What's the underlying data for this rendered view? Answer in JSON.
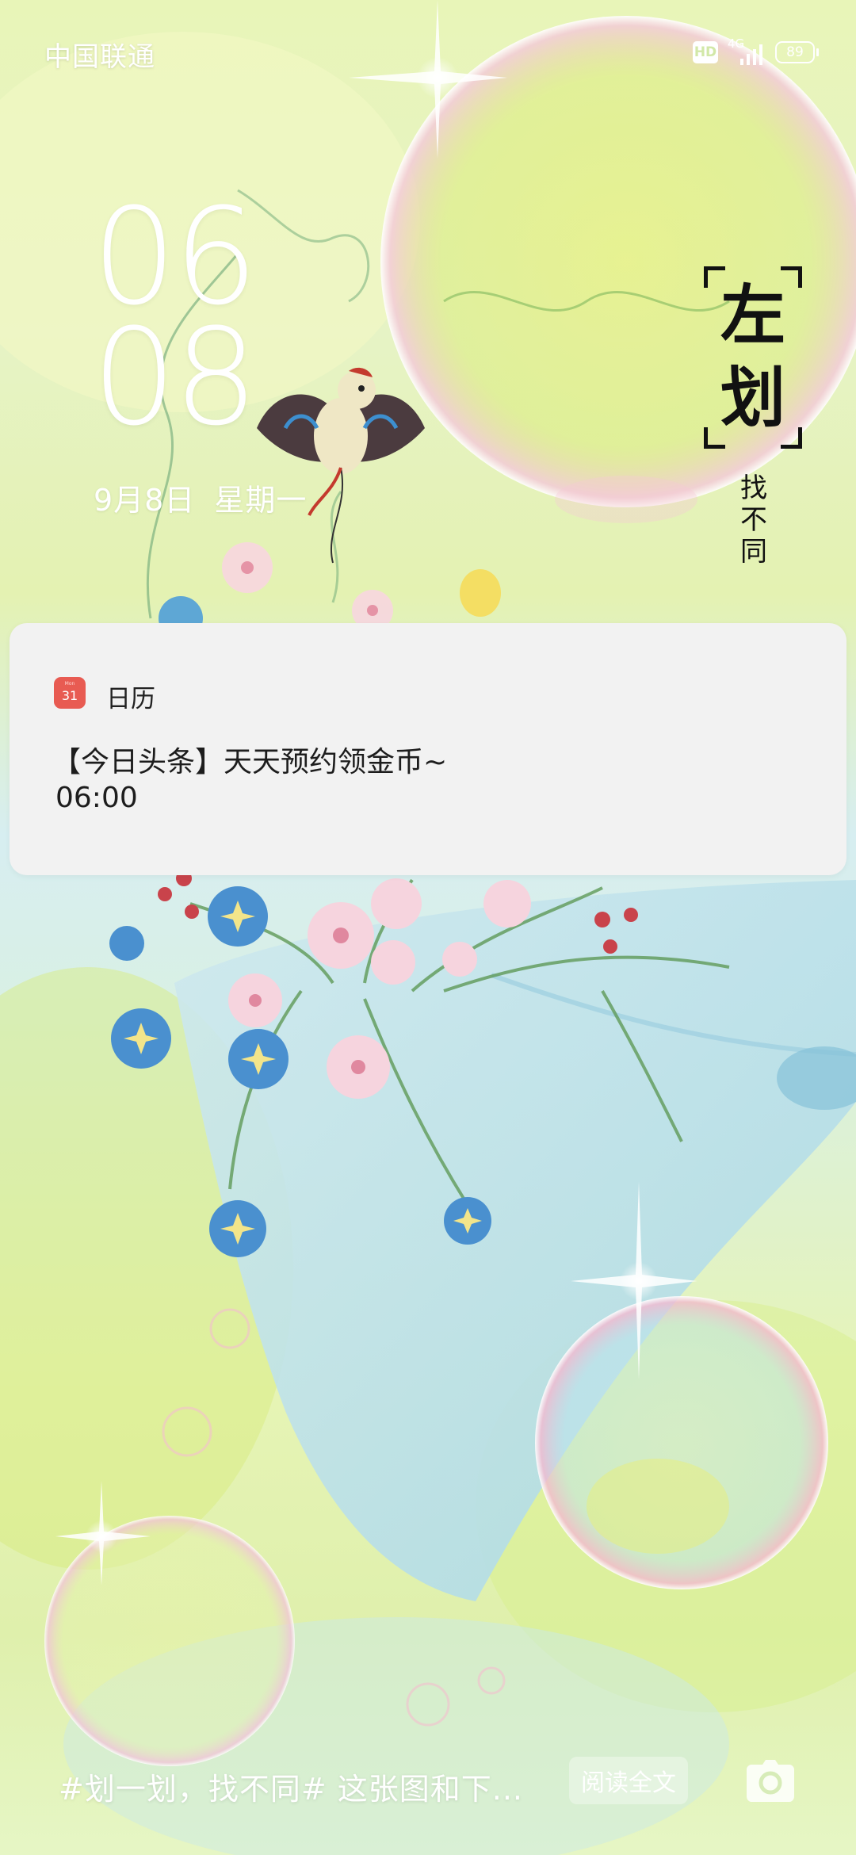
{
  "status_bar": {
    "carrier": "中国联通",
    "hd_label": "HD",
    "network_label": "4G",
    "battery_percent": "89"
  },
  "lock_screen": {
    "clock_hour": "06",
    "clock_minute": "08",
    "date": "9月8日",
    "weekday": "星期一"
  },
  "theme_mark": {
    "big_chars": [
      "左",
      "划"
    ],
    "small_chars": [
      "找",
      "不",
      "同"
    ]
  },
  "notification": {
    "app_name": "日历",
    "icon_month": "Mon",
    "icon_day": "31",
    "title": "【今日头条】天天预约领金币~",
    "time": "06:00"
  },
  "bottom_bar": {
    "caption": "#划一划，找不同#  这张图和下...",
    "read_more_label": "阅读全文"
  },
  "icons": {
    "camera": "camera-icon",
    "signal": "signal-icon",
    "battery": "battery-icon",
    "hd": "hd-icon",
    "calendar": "calendar-app-icon"
  },
  "colors": {
    "notification_bg": "#f2f2f2",
    "calendar_icon": "#e85b52",
    "text_white": "#ffffff",
    "theme_ink": "#111111"
  }
}
